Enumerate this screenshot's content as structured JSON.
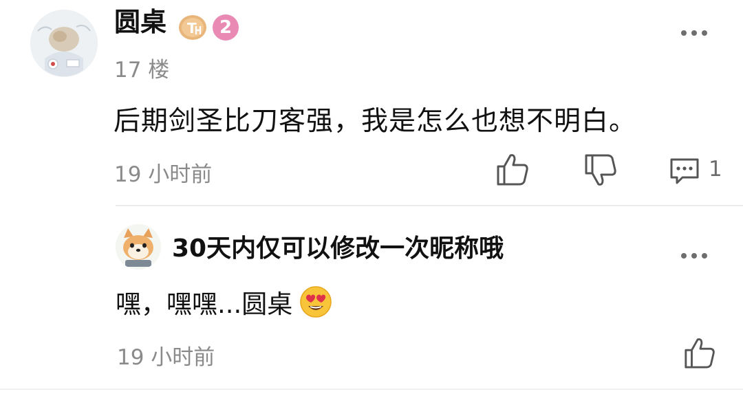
{
  "main_comment": {
    "username": "圆桌",
    "badge_th": "T",
    "level": "2",
    "floor": "17 楼",
    "content": "后期剑圣比刀客强，我是怎么也想不明白。",
    "time": "19 小时前",
    "reply_count": "1",
    "icons": {
      "avatar": "user-avatar",
      "more": "more-dots-icon",
      "like": "thumbs-up-icon",
      "dislike": "thumbs-down-icon",
      "reply": "comment-icon"
    }
  },
  "reply": {
    "username": "30天内仅可以修改一次昵称哦",
    "content": "嘿，嘿嘿...圆桌",
    "emoji": "heart-eyes-emoji",
    "time": "19 小时前",
    "icons": {
      "avatar": "shiba-avatar",
      "more": "more-dots-icon",
      "like": "thumbs-up-icon"
    }
  },
  "colors": {
    "text_primary": "#111111",
    "text_secondary": "#8a8a8a",
    "level_badge": "#e98ab5",
    "th_badge": "#e8b57a",
    "divider": "#ececec"
  }
}
